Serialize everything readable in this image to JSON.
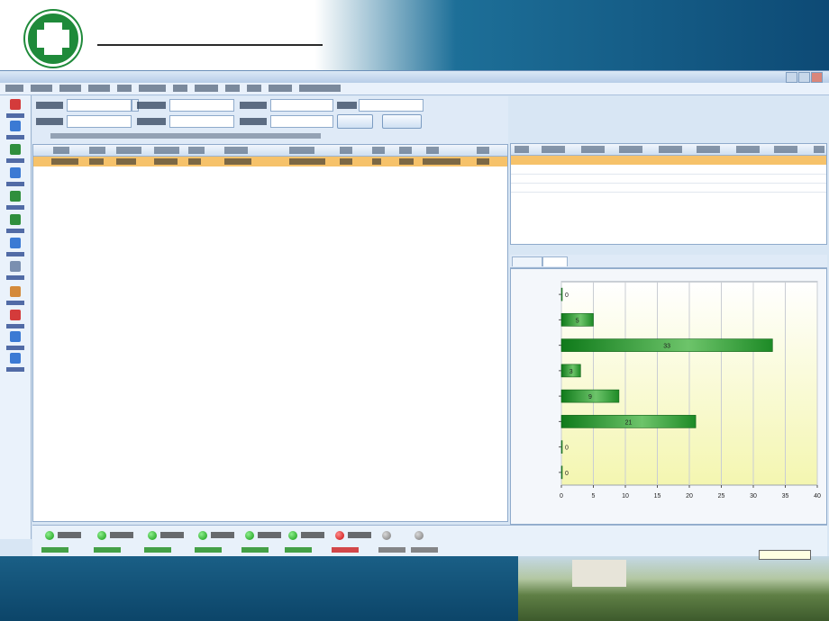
{
  "colors": {
    "banner_green": "#1f8a3a",
    "selected_row": "#f6c26a",
    "bar_green": "#1f9a2a",
    "alert_red": "#c90b0b"
  },
  "icons": [
    "hospital-cross-logo-icon",
    "minimize-icon",
    "maximize-icon",
    "close-icon",
    "dropdown-arrow-icon",
    "status-light-icon"
  ],
  "chart_data": {
    "type": "bar",
    "orientation": "horizontal",
    "values": [
      0,
      5,
      33,
      3,
      9,
      21,
      0,
      0
    ],
    "xlim": [
      0,
      40
    ],
    "xticks": [
      0,
      5,
      10,
      15,
      20,
      25,
      30,
      35,
      40
    ],
    "grid": true,
    "legend": "none"
  },
  "status_lights": [
    "green",
    "green",
    "green",
    "green",
    "green",
    "green",
    "red",
    "gray",
    "gray"
  ]
}
